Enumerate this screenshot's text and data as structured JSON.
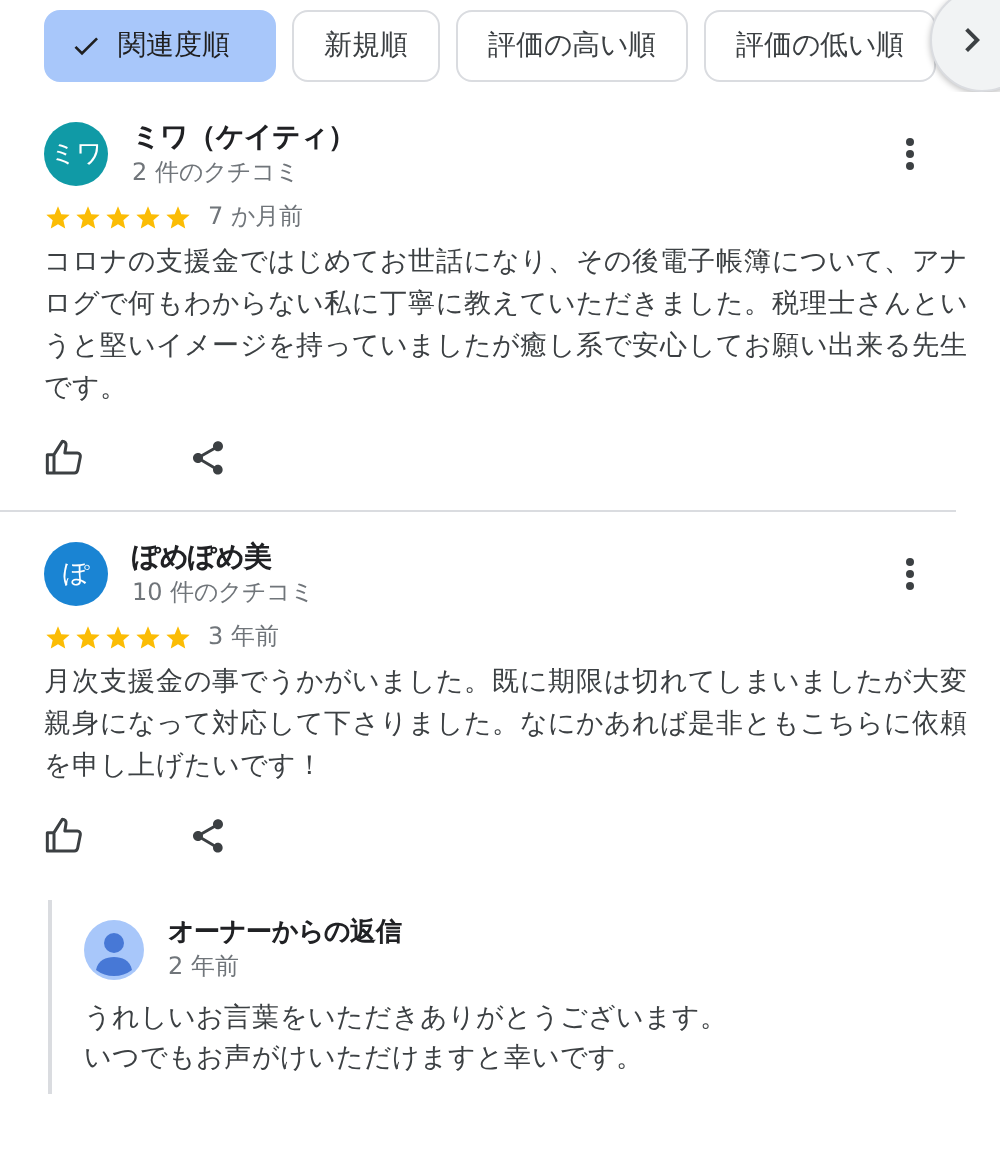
{
  "sort_chips": [
    {
      "label": "関連度順",
      "selected": true
    },
    {
      "label": "新規順",
      "selected": false
    },
    {
      "label": "評価の高い順",
      "selected": false
    },
    {
      "label": "評価の低い順",
      "selected": false
    }
  ],
  "reviews": [
    {
      "initials": "ミワ",
      "color": "#109aa6",
      "name": "ミワ（ケイティ）",
      "review_count": "2 件のクチコミ",
      "stars": 5,
      "time": "7 か月前",
      "text": "コロナの支援金ではじめてお世話になり、その後電子帳簿について、アナログで何もわからない私に丁寧に教えていただきました。税理士さんというと堅いイメージを持っていましたが癒し系で安心してお願い出来る先生です。"
    },
    {
      "initials": "ぽ",
      "color": "#1a84d3",
      "name": "ぽめぽめ美",
      "review_count": "10 件のクチコミ",
      "stars": 5,
      "time": "3 年前",
      "text": "月次支援金の事でうかがいました。既に期限は切れてしまいましたが大変親身になって対応して下さりました。なにかあれば是非ともこちらに依頼を申し上げたいです！",
      "owner_reply": {
        "title": "オーナーからの返信",
        "time": "2 年前",
        "lines": [
          "うれしいお言葉をいただきありがとうございます。",
          "いつでもお声がけいただけますと幸いです。"
        ]
      }
    }
  ]
}
